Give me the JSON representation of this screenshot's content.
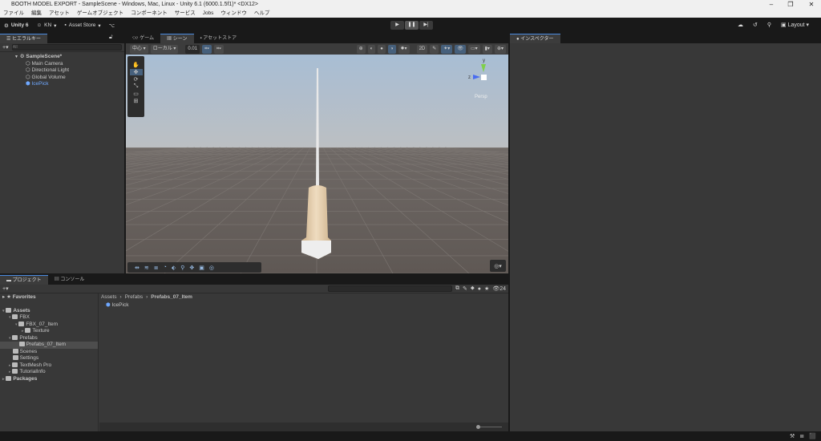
{
  "window": {
    "title": "BOOTH MODEL EXPORT - SampleScene - Windows, Mac, Linux - Unity 6.1 (6000.1.5f1)* <DX12>",
    "controls": [
      "–",
      "❐",
      "✕"
    ]
  },
  "menu": [
    "ファイル",
    "編集",
    "アセット",
    "ゲームオブジェクト",
    "コンポーネント",
    "サービス",
    "Jobs",
    "ウィンドウ",
    "ヘルプ"
  ],
  "toolbar": {
    "unity": "Unity 6",
    "account": "KN",
    "asset_store": "Asset Store",
    "layout": "Layout"
  },
  "hierarchy": {
    "tab": "ヒエラルキー",
    "search_placeholder": "All",
    "scene": "SampleScene*",
    "items": [
      "Main Camera",
      "Directional Light",
      "Global Volume",
      "IcePick"
    ]
  },
  "scene_tabs": [
    "ゲーム",
    "シーン",
    "アセットストア"
  ],
  "scene_toolbar": {
    "pivot": "中心",
    "space": "ローカル",
    "snap": "0.01"
  },
  "gizmo": {
    "y": "y",
    "z": "z",
    "persp": "Persp"
  },
  "inspector": {
    "tab": "インスペクター"
  },
  "project": {
    "tabs": [
      "プロジェクト",
      "コンソール"
    ],
    "hidden_count": "24",
    "favorites": "Favorites",
    "tree": [
      {
        "label": "Assets",
        "depth": 0,
        "open": true
      },
      {
        "label": "FBX",
        "depth": 1,
        "open": true
      },
      {
        "label": "FBX_07_Item",
        "depth": 2,
        "open": true
      },
      {
        "label": "Texture",
        "depth": 3
      },
      {
        "label": "Prefabs",
        "depth": 1,
        "open": true
      },
      {
        "label": "Prefabs_07_Item",
        "depth": 2,
        "selected": true
      },
      {
        "label": "Scenes",
        "depth": 1
      },
      {
        "label": "Settings",
        "depth": 1
      },
      {
        "label": "TextMesh Pro",
        "depth": 1
      },
      {
        "label": "TutorialInfo",
        "depth": 1
      },
      {
        "label": "Packages",
        "depth": 0
      }
    ],
    "breadcrumb": [
      "Assets",
      "Prefabs",
      "Prefabs_07_Item"
    ],
    "files": [
      "IcePick"
    ]
  }
}
